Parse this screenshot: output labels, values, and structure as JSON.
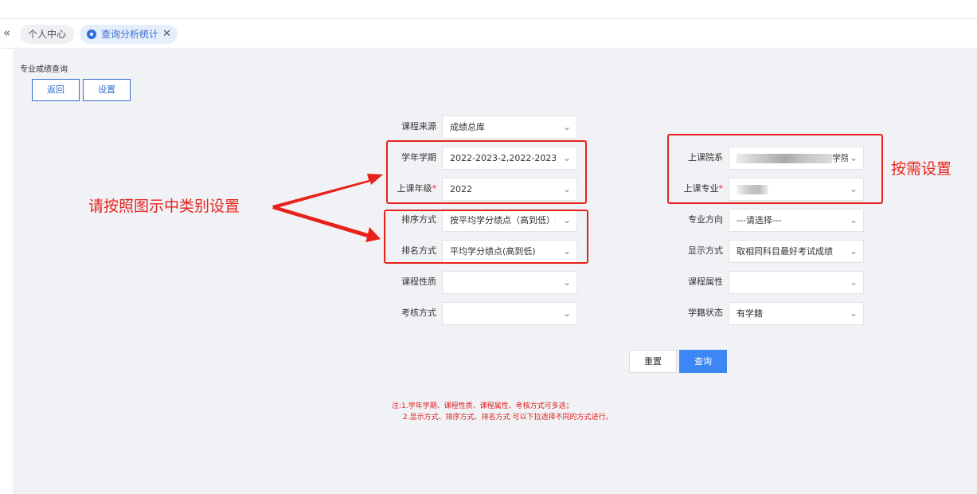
{
  "tabs": {
    "collapse_glyph": "«",
    "home": "个人中心",
    "active": "查询分析统计",
    "close_glyph": "✕"
  },
  "page": {
    "title": "专业成绩查询",
    "back_button": "返回",
    "settings_button": "设置"
  },
  "left_form": [
    {
      "label": "课程来源",
      "value": "成绩总库",
      "required": false
    },
    {
      "label": "学年学期",
      "value": "2022-2023-2,2022-2023-1",
      "required": false
    },
    {
      "label": "上课年级",
      "value": "2022",
      "required": true
    },
    {
      "label": "排序方式",
      "value": "按平均学分绩点（高到低）排",
      "required": false
    },
    {
      "label": "排名方式",
      "value": "平均学分绩点(高到低)",
      "required": false
    },
    {
      "label": "课程性质",
      "value": "",
      "required": false
    },
    {
      "label": "考核方式",
      "value": "",
      "required": false
    }
  ],
  "right_form": [
    {
      "label": "上课院系",
      "value": "学院",
      "required": false
    },
    {
      "label": "上课专业",
      "value": "",
      "required": true
    },
    {
      "label": "专业方向",
      "value": "---请选择---",
      "required": false
    },
    {
      "label": "显示方式",
      "value": "取相同科目最好考试成绩",
      "required": false
    },
    {
      "label": "课程属性",
      "value": "",
      "required": false
    },
    {
      "label": "学籍状态",
      "value": "有学籍",
      "required": false
    }
  ],
  "required_mark": "*",
  "chevron": "⌄",
  "actions": {
    "reset": "重置",
    "query": "查询"
  },
  "notes": {
    "line1": "注:1.学年学期、课程性质、课程属性、考核方式可多选；",
    "line2": "2.显示方式、排序方式、排名方式 可以下拉选择不同的方式进行。"
  },
  "annotations": {
    "left": "请按照图示中类别设置",
    "right": "按需设置"
  },
  "colors": {
    "accent": "#3d87f5",
    "annotation_red": "#e8221b",
    "note_red": "#e02020",
    "background": "#f0f2f5"
  }
}
